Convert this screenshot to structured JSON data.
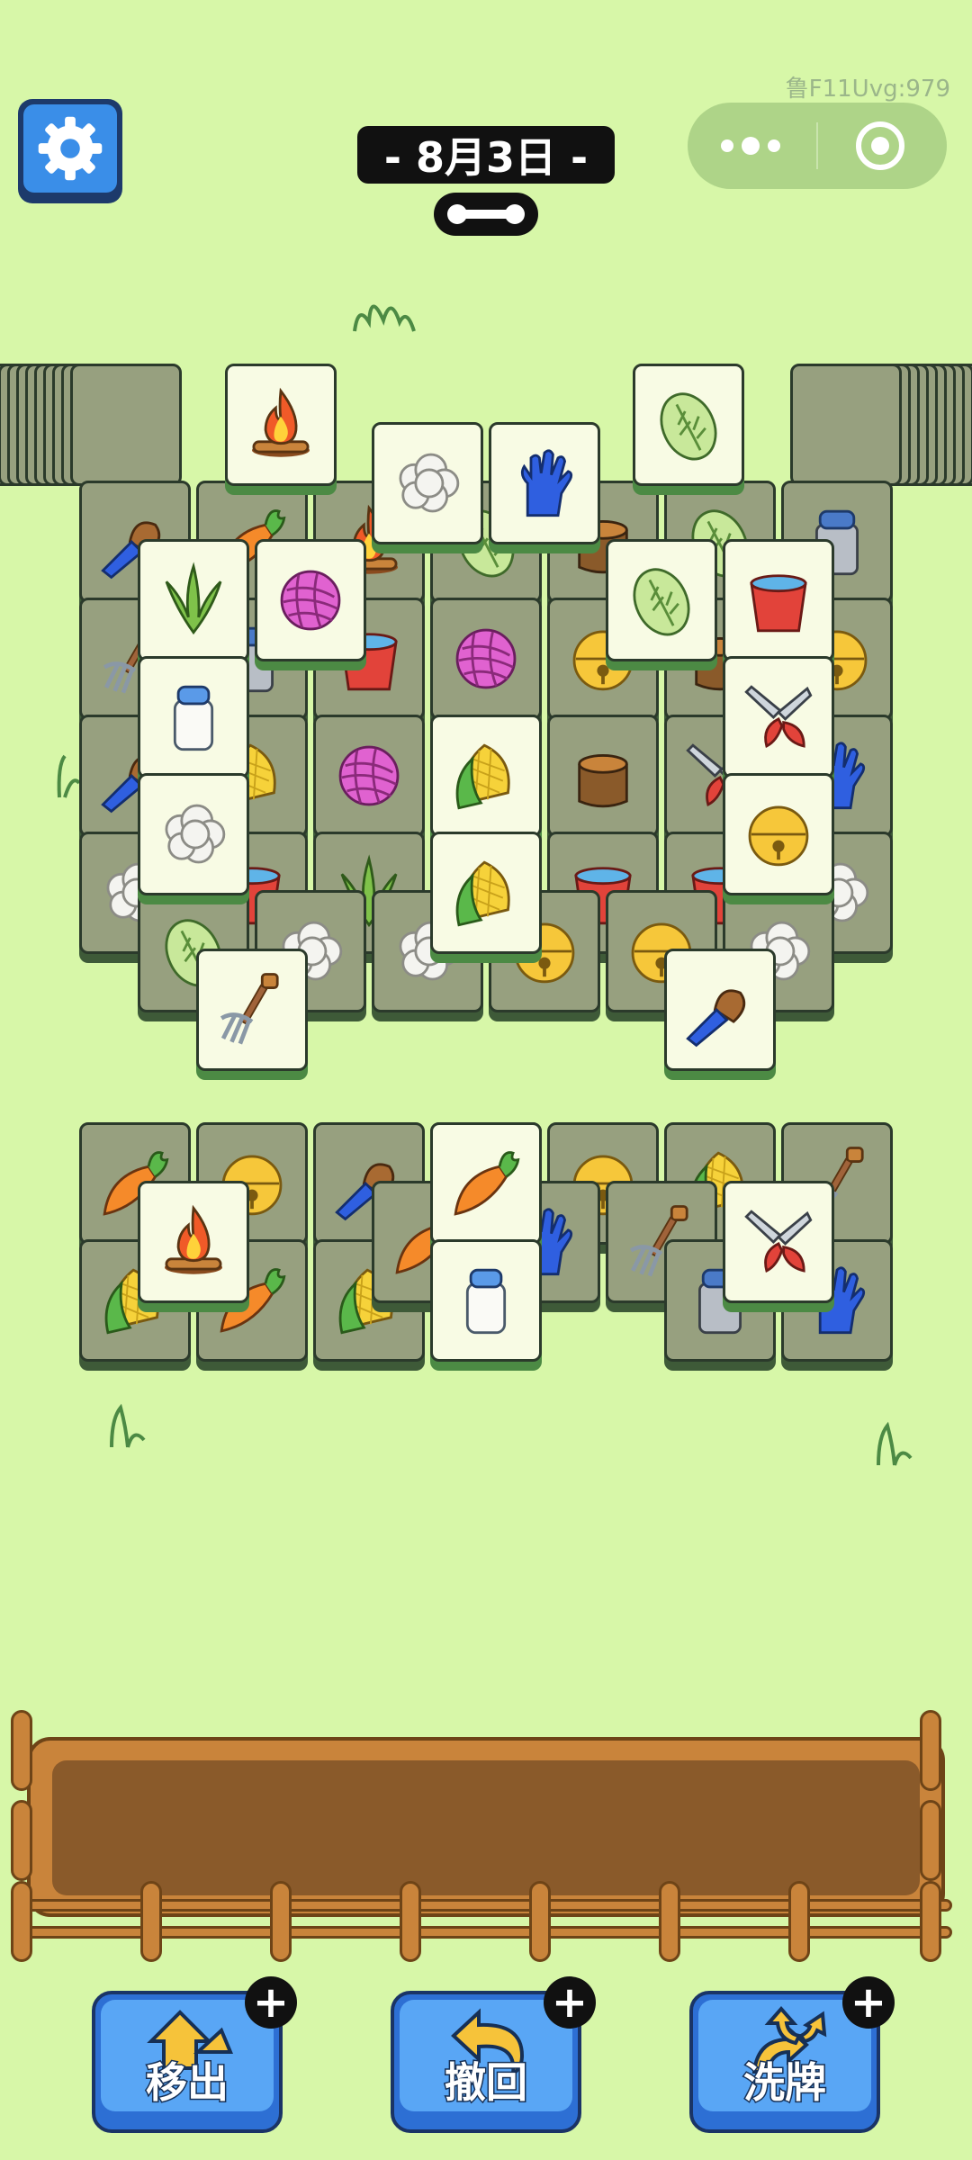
{
  "header": {
    "date_label": "- 8月3日 -",
    "watermark": "鲁F11Uvg:979"
  },
  "icons": {
    "settings": "gear-icon",
    "more": "more-dots-icon",
    "close": "target-close-icon"
  },
  "toolbar": {
    "move_out_label": "移出",
    "undo_label": "撤回",
    "shuffle_label": "洗牌",
    "plus_symbol": "+"
  },
  "tile_kinds": [
    "campfire",
    "cabbage",
    "cotton",
    "glove",
    "grass",
    "yarn",
    "bucket",
    "milk",
    "corn",
    "shears",
    "bell",
    "pitchfork",
    "brush",
    "carrot",
    "stump",
    "can"
  ],
  "colors": {
    "background": "#d7f7a8",
    "tile_face": "#f8fbe4",
    "tile_dim": "#97a07f",
    "button_blue": "#59a6f5",
    "tray_brown": "#8a5a2a"
  }
}
